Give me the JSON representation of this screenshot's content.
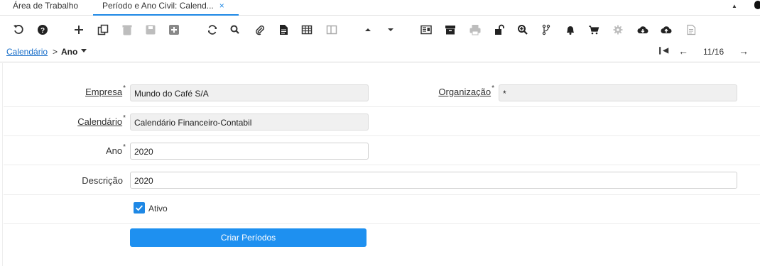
{
  "tabs": {
    "desktop": "Área de Trabalho",
    "active": "Período e Ano Civil: Calend...",
    "close": "×"
  },
  "toolbar": {
    "icons": [
      "undo-icon",
      "help-icon",
      "new-icon",
      "copy-icon",
      "delete-icon",
      "save-icon",
      "save-new-icon",
      "refresh-icon",
      "find-icon",
      "attachment-icon",
      "document-icon",
      "grid-toggle-icon",
      "split-view-icon",
      "parent-icon",
      "detail-icon",
      "report-icon",
      "archive-icon",
      "print-icon",
      "lock-icon",
      "zoom-across-icon",
      "workflow-icon",
      "notification-icon",
      "cart-icon",
      "settings-icon",
      "export-icon",
      "import-icon",
      "post-it-icon"
    ]
  },
  "breadcrumb": {
    "link": "Calendário",
    "separator": ">",
    "current": "Ano"
  },
  "navigation": {
    "record_count": "11/16"
  },
  "form": {
    "empresa_label": "Empresa",
    "empresa_value": "Mundo do Café S/A",
    "organizacao_label": "Organização",
    "organizacao_value": "*",
    "calendario_label": "Calendário",
    "calendario_value": "Calendário Financeiro-Contabil",
    "ano_label": "Ano",
    "ano_value": "2020",
    "descricao_label": "Descrição",
    "descricao_value": "2020",
    "ativo_label": "Ativo",
    "required_mark": "*"
  },
  "actions": {
    "criar_periodos": "Criar Períodos"
  },
  "colors": {
    "accent": "#1e88e5",
    "button": "#1e90f0"
  }
}
